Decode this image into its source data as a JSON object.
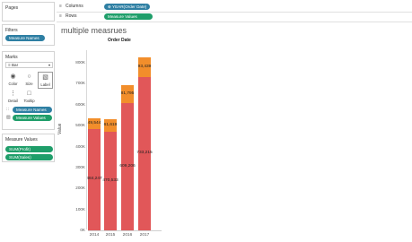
{
  "left": {
    "pages": {
      "title": "Pages"
    },
    "filters": {
      "title": "Filters",
      "pill": "Measure Names"
    },
    "marks": {
      "title": "Marks",
      "type": "Bar",
      "buttons": {
        "color": "Color",
        "size": "Size",
        "label": "Label",
        "detail": "Detail",
        "tooltip": "Tooltip"
      },
      "pills": [
        "Measure Names",
        "Measure Values"
      ]
    },
    "measure_values": {
      "title": "Measure Values",
      "pills": [
        "SUM(Profit)",
        "SUM(Sales)"
      ]
    }
  },
  "shelves": {
    "columns": {
      "label": "Columns",
      "pill": "YEAR(Order Date)"
    },
    "rows": {
      "label": "Rows",
      "pill": "Measure Values"
    }
  },
  "sheet": {
    "title": "multiple measrues",
    "column_header": "Order Date",
    "y_axis_label": "Value"
  },
  "colors": {
    "sales": "#e15759",
    "profit": "#f28e2b"
  },
  "chart_data": {
    "type": "bar",
    "stacked": true,
    "categories": [
      "2014",
      "2015",
      "2016",
      "2017"
    ],
    "series": [
      {
        "values": [
          484247,
          470533,
          609206,
          733215
        ],
        "labels": [
          "484,247",
          "470,533",
          "609,206",
          "733,215"
        ]
      },
      {
        "values": [
          49544,
          61619,
          81795,
          93439
        ],
        "labels": [
          "49,544",
          "61,619",
          "81,795",
          "93,439"
        ]
      }
    ],
    "ylabel": "Value",
    "ylim": [
      0,
      860000
    ],
    "yticks": [
      0,
      100000,
      200000,
      300000,
      400000,
      500000,
      600000,
      700000,
      800000
    ],
    "ytick_labels": [
      "0K",
      "100K",
      "200K",
      "300K",
      "400K",
      "500K",
      "600K",
      "700K",
      "800K"
    ]
  }
}
